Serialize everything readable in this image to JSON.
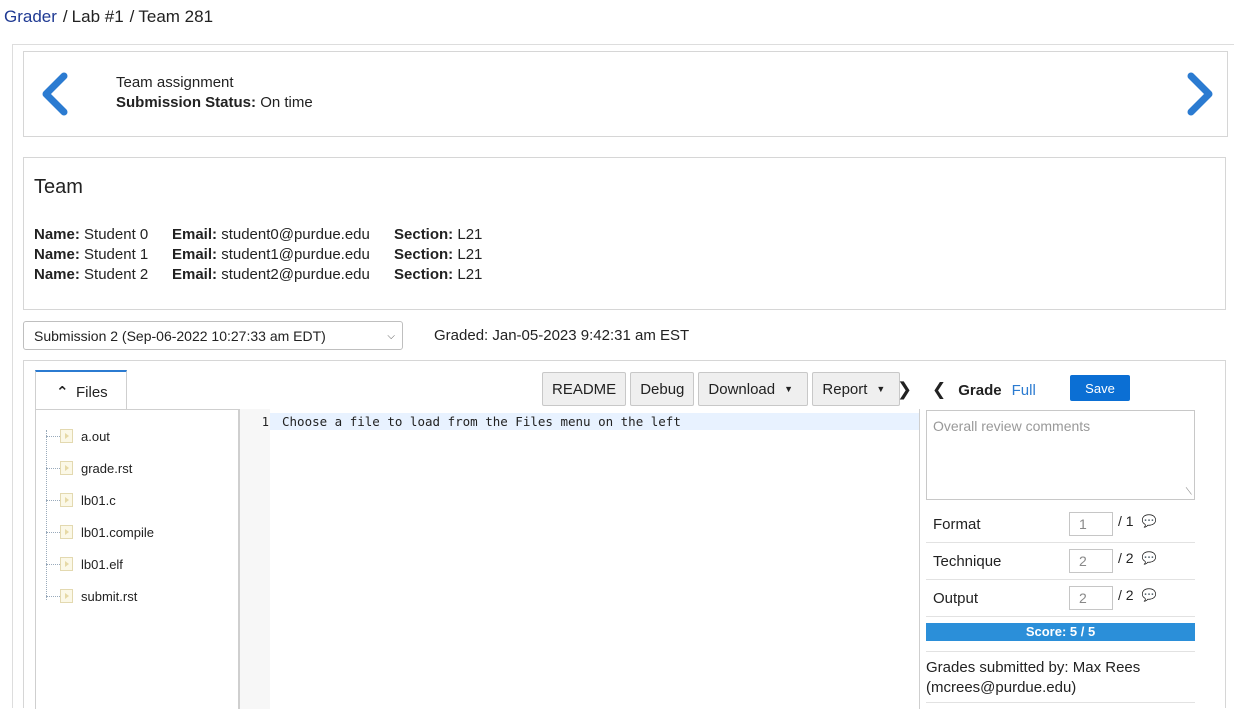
{
  "breadcrumb": {
    "root": "Grader",
    "parts": [
      "Lab #1",
      "Team 281"
    ]
  },
  "assignment": {
    "type": "Team assignment",
    "status_label": "Submission Status:",
    "status_value": "On time"
  },
  "team": {
    "title": "Team",
    "labels": {
      "name": "Name:",
      "email": "Email:",
      "section": "Section:"
    },
    "members": [
      {
        "name": "Student 0",
        "email": "student0@purdue.edu",
        "section": "L21"
      },
      {
        "name": "Student 1",
        "email": "student1@purdue.edu",
        "section": "L21"
      },
      {
        "name": "Student 2",
        "email": "student2@purdue.edu",
        "section": "L21"
      }
    ]
  },
  "submission": {
    "selected": "Submission 2 (Sep-06-2022 10:27:33 am EDT)",
    "graded": "Graded: Jan-05-2023 9:42:31 am EST"
  },
  "files": {
    "tab_label": "Files",
    "items": [
      "a.out",
      "grade.rst",
      "lb01.c",
      "lb01.compile",
      "lb01.elf",
      "submit.rst"
    ]
  },
  "toolbar": {
    "readme": "README",
    "debug": "Debug",
    "download": "Download",
    "report": "Report"
  },
  "editor": {
    "line_number": "1",
    "line_text": "Choose a file to load from the Files menu on the left"
  },
  "grade": {
    "title": "Grade",
    "mode": "Full",
    "save_label": "Save",
    "comments_placeholder": "Overall review comments",
    "criteria": [
      {
        "name": "Format",
        "value": "1",
        "max": "/ 1"
      },
      {
        "name": "Technique",
        "value": "2",
        "max": "/ 2"
      },
      {
        "name": "Output",
        "value": "2",
        "max": "/ 2"
      }
    ],
    "score": "Score:  5 / 5",
    "submitted_by": "Grades submitted by: Max Rees (mcrees@purdue.edu)"
  },
  "colors": {
    "accent": "#2b7bd1",
    "save_button": "#0b6fd4",
    "score_bar": "#2b8fd9"
  }
}
